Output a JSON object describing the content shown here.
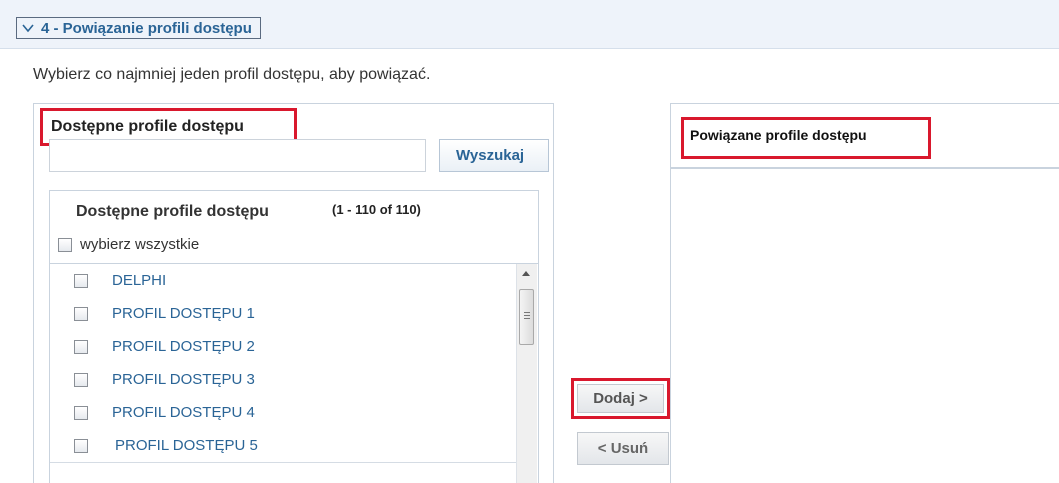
{
  "section": {
    "title": "4 - Powiązanie profili dostępu",
    "toggle_icon": "chevron-down-icon"
  },
  "instruction": "Wybierz co najmniej jeden profil dostępu, aby powiązać.",
  "available": {
    "panel_title": "Dostępne profile dostępu",
    "search": {
      "value": "",
      "button_label": "Wyszukaj"
    },
    "list": {
      "header_title": "Dostępne profile dostępu",
      "count": "(1 - 110 of 110)",
      "select_all_label": "wybierz wszystkie",
      "items": [
        {
          "label": "DELPHI",
          "checked": false
        },
        {
          "label": "PROFIL DOSTĘPU 1",
          "checked": false
        },
        {
          "label": "PROFIL DOSTĘPU 2",
          "checked": false
        },
        {
          "label": "PROFIL DOSTĘPU 3",
          "checked": false
        },
        {
          "label": "PROFIL DOSTĘPU 4",
          "checked": false
        },
        {
          "label": "PROFIL DOSTĘPU 5",
          "checked": false
        }
      ]
    }
  },
  "actions": {
    "add_label": "Dodaj >",
    "remove_label": "< Usuń"
  },
  "associated": {
    "panel_title": "Powiązane profile dostępu"
  },
  "colors": {
    "highlight": "#d9182d",
    "link": "#2a6496"
  }
}
